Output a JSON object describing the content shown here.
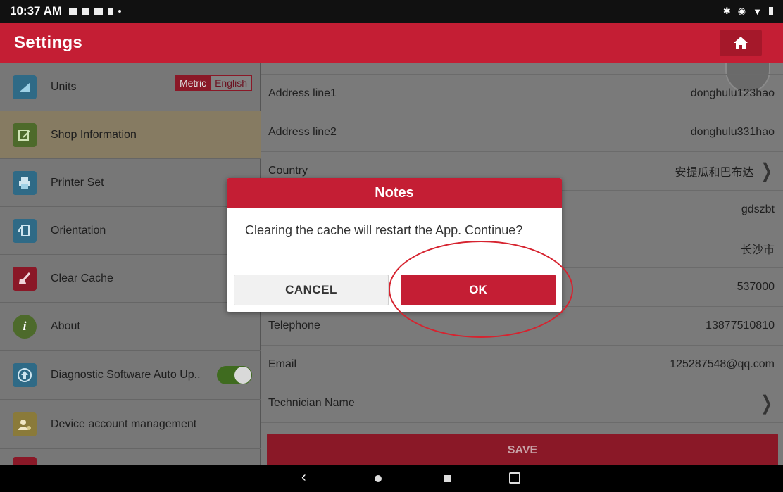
{
  "status_bar": {
    "time": "10:37 AM"
  },
  "header": {
    "title": "Settings"
  },
  "sidebar": {
    "items": [
      {
        "label": "Units",
        "icon": "units-ruler-icon"
      },
      {
        "label": "Shop Information",
        "icon": "edit-document-icon"
      },
      {
        "label": "Printer Set",
        "icon": "printer-icon"
      },
      {
        "label": "Orientation",
        "icon": "orientation-icon"
      },
      {
        "label": "Clear Cache",
        "icon": "broom-icon"
      },
      {
        "label": "About",
        "icon": "info-icon"
      },
      {
        "label": "Diagnostic Software Auto Up..",
        "icon": "upload-icon"
      },
      {
        "label": "Device account management",
        "icon": "account-icon"
      }
    ],
    "units_metric": "Metric",
    "units_english": "English",
    "auto_update_on": true
  },
  "shop_form": {
    "rows": [
      {
        "label": "Address line1",
        "value": "donghulu123hao"
      },
      {
        "label": "Address line2",
        "value": "donghulu331hao"
      },
      {
        "label": "Country",
        "value": "安提瓜和巴布达"
      },
      {
        "label": "",
        "value": "gdszbt"
      },
      {
        "label": "",
        "value": "长沙市"
      },
      {
        "label": "",
        "value": "537000"
      },
      {
        "label": "Telephone",
        "value": "13877510810"
      },
      {
        "label": "Email",
        "value": "125287548@qq.com"
      },
      {
        "label": "Technician Name",
        "value": ""
      }
    ],
    "save_label": "SAVE"
  },
  "dialog": {
    "title": "Notes",
    "message": "Clearing the cache will restart the App. Continue?",
    "cancel_label": "CANCEL",
    "ok_label": "OK"
  },
  "colors": {
    "brand_red": "#c41e34",
    "dimmed_red": "#8a1827",
    "annotation_red": "#d6232f"
  }
}
